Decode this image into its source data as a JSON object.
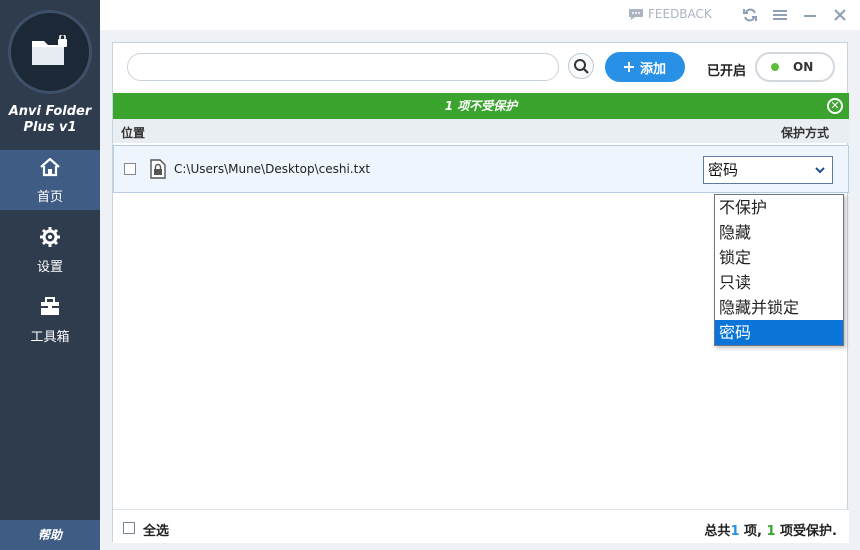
{
  "app": {
    "name_line1": "Anvi Folder",
    "name_line2": "Plus v1"
  },
  "titlebar": {
    "feedback_label": "FEEDBACK"
  },
  "sidebar": {
    "items": [
      {
        "label": "首页",
        "icon": "home-icon",
        "active": true
      },
      {
        "label": "设置",
        "icon": "gear-icon",
        "active": false
      },
      {
        "label": "工具箱",
        "icon": "toolbox-icon",
        "active": false
      }
    ],
    "help_label": "帮助"
  },
  "toolbar": {
    "search_value": "",
    "add_label": "添加",
    "enabled_label": "已开启",
    "toggle_label": "ON"
  },
  "status": {
    "message": "1 项不受保护",
    "color": "#3aa42f"
  },
  "table": {
    "columns": {
      "location": "位置",
      "mode": "保护方式"
    },
    "rows": [
      {
        "path": "C:\\Users\\Mune\\Desktop\\ceshi.txt",
        "mode": "密码"
      }
    ]
  },
  "dropdown": {
    "options": [
      "不保护",
      "隐藏",
      "锁定",
      "只读",
      "隐藏并锁定",
      "密码"
    ],
    "selected": "密码"
  },
  "footer": {
    "select_all_label": "全选",
    "summary_prefix": "总共",
    "total_count": "1",
    "summary_mid": " 项, ",
    "protected_count": "1",
    "summary_suffix": " 项受保护."
  },
  "colors": {
    "sidebar": "#2e3c4e",
    "accent": "#2891e6",
    "success": "#3aa42f"
  }
}
